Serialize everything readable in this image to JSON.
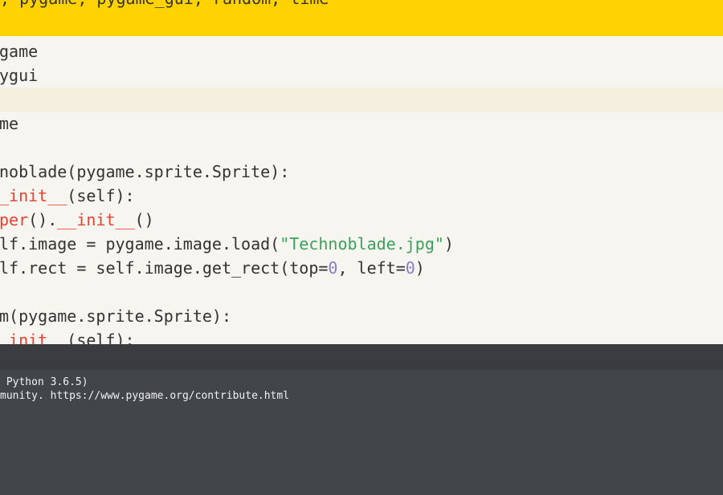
{
  "toolbar": {
    "title_fragment": "; pygame, pygame_gui, random, time"
  },
  "editor": {
    "lines": [
      "game",
      "ygui",
      "",
      "me",
      "",
      "noblade(pygame.sprite.Sprite):",
      "_init__(self):",
      "per().__init__()",
      "lf.image = pygame.image.load(\"Technoblade.jpg\")",
      "lf.rect = self.image.get_rect(top=0, left=0)",
      "",
      "m(pygame.sprite.Sprite):",
      "_init__(self):"
    ],
    "highlight": {
      "l6_red": "_init__",
      "l6_rest": "(self):",
      "l7_red1": "per",
      "l7_mid": "().",
      "l7_red2": "__init__",
      "l7_end": "()",
      "l8_pre": "lf.image = pygame.image.load(",
      "l8_str": "\"Technoblade.jpg\"",
      "l8_end": ")",
      "l9_pre": "lf.rect = self.image.get_rect(top=",
      "l9_n1": "0",
      "l9_mid": ", left=",
      "l9_n2": "0",
      "l9_end": ")",
      "l12_red": "_init__",
      "l12_rest": "(self):"
    },
    "colors": {
      "keyword": "#e8412f",
      "string": "#3ba05b",
      "number": "#8a7cc6"
    }
  },
  "console": {
    "lines": [
      " Python 3.6.5)",
      "munity. https://www.pygame.org/contribute.html"
    ]
  },
  "colors": {
    "toolbar": "#ffd200",
    "editor_bg": "#f7f5f0",
    "console_bg": "#42454a"
  }
}
